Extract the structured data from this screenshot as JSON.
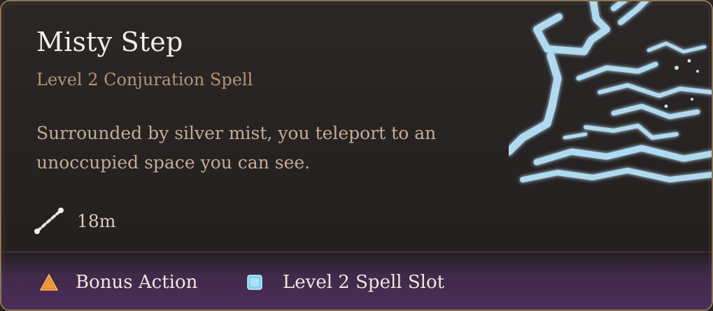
{
  "spell": {
    "name": "Misty Step",
    "school_line": "Level 2 Conjuration Spell",
    "description": "Surrounded by silver mist, you teleport to an unoccupied space you can see.",
    "range": "18m",
    "range_icon": "range-icon",
    "art_icon": "misty-step-spell-art"
  },
  "costs": [
    {
      "label": "Bonus Action",
      "icon": "triangle-icon",
      "color": "#e98a2c"
    },
    {
      "label": "Level 2 Spell Slot",
      "icon": "square-icon",
      "color": "#7fd3f2"
    }
  ],
  "colors": {
    "border": "#8c7650",
    "title": "#f2ede6",
    "subtitle": "#b49474",
    "body": "#c3ad93",
    "footer": "#4b2d5a",
    "art": "#a9dcf6"
  }
}
